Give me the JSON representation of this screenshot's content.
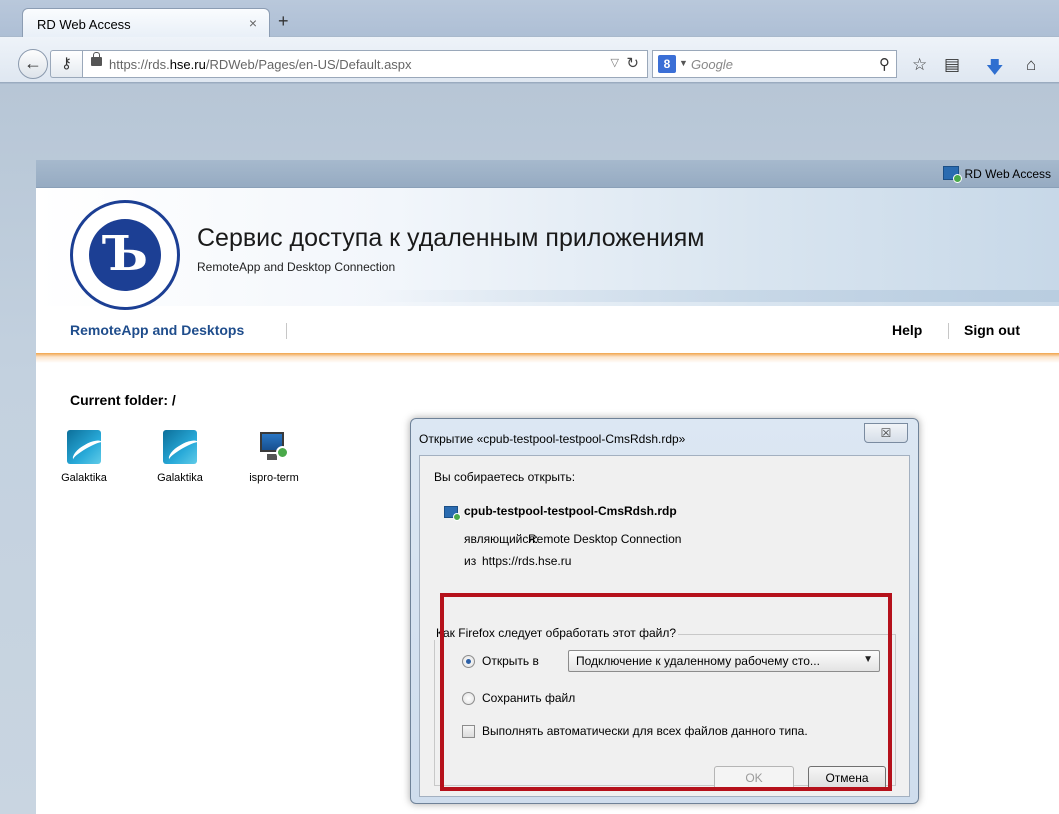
{
  "browser": {
    "tab_title": "RD Web Access",
    "tab_close": "×",
    "new_tab": "+",
    "url_prefix": "https://rds.",
    "url_domain": "hse.ru",
    "url_path": "/RDWeb/Pages/en-US/Default.aspx",
    "search_placeholder": "Google",
    "icons": [
      "back-arrow-icon",
      "key-icon",
      "lock-icon",
      "reload-icon",
      "google-icon",
      "search-icon",
      "bookmark-star-icon",
      "bookmarks-list-icon",
      "download-icon",
      "home-icon"
    ]
  },
  "page": {
    "window_label": "RD Web Access",
    "title": "Сервис доступа к удаленным приложениям",
    "subtitle": "RemoteApp and Desktop Connection",
    "nav": {
      "main": "RemoteApp and Desktops",
      "help": "Help",
      "sign_out": "Sign out"
    },
    "current_folder": "Current folder: /",
    "apps": [
      {
        "label": "Galaktika",
        "icon": "galaktika-icon"
      },
      {
        "label": "Galaktika",
        "icon": "galaktika-icon"
      },
      {
        "label": "ispro-term",
        "icon": "remote-desktop-icon"
      }
    ],
    "accent_orange": "#f1a44a",
    "link_blue": "#1f4d8c"
  },
  "dialog": {
    "title": "Открытие «cpub-testpool-testpool-CmsRdsh.rdp»",
    "close": "☒",
    "intro": "Вы собираетесь открыть:",
    "filename": "cpub-testpool-testpool-CmsRdsh.rdp",
    "type_label": "являющийся:",
    "type_value": "Remote Desktop Connection",
    "from_label": "из",
    "from_value": "https://rds.hse.ru",
    "question": "Как Firefox следует обработать этот файл?",
    "open_with_label": "Открыть в",
    "open_with_value": "Подключение к удаленному рабочему сто...",
    "save_label": "Сохранить файл",
    "auto_label": "Выполнять автоматически для всех файлов данного типа.",
    "ok": "OK",
    "cancel": "Отмена",
    "highlight_color": "#b5111b"
  }
}
